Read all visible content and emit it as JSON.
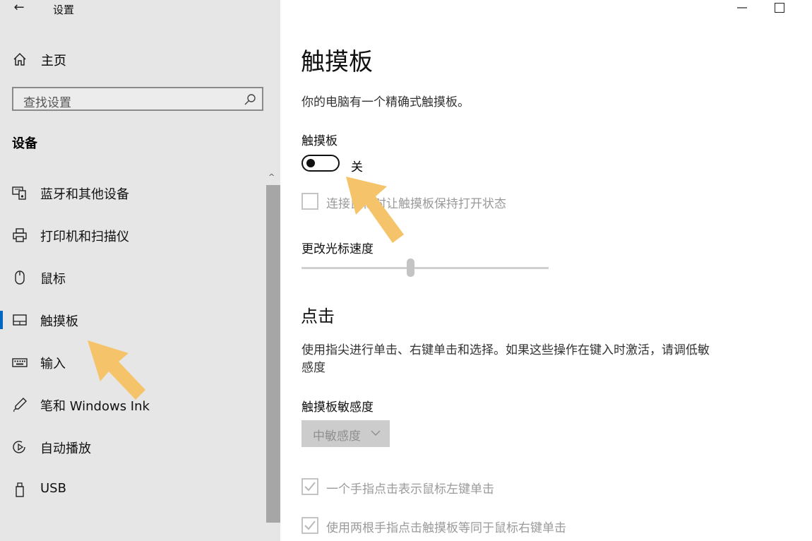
{
  "window": {
    "title": "设置",
    "back_glyph": "←",
    "minimize_icon": "minimize-icon",
    "maximize_icon": "maximize-icon"
  },
  "sidebar": {
    "home_label": "主页",
    "search_placeholder": "查找设置",
    "section_title": "设备",
    "items": [
      {
        "label": "蓝牙和其他设备",
        "icon": "bluetooth-devices-icon"
      },
      {
        "label": "打印机和扫描仪",
        "icon": "printer-icon"
      },
      {
        "label": "鼠标",
        "icon": "mouse-icon"
      },
      {
        "label": "触摸板",
        "icon": "touchpad-icon",
        "active": true
      },
      {
        "label": "输入",
        "icon": "keyboard-icon"
      },
      {
        "label": "笔和 Windows Ink",
        "icon": "pen-icon"
      },
      {
        "label": "自动播放",
        "icon": "autoplay-icon"
      },
      {
        "label": "USB",
        "icon": "usb-icon"
      }
    ]
  },
  "main": {
    "title": "触摸板",
    "description": "你的电脑有一个精确式触摸板。",
    "touchpad_label": "触摸板",
    "toggle_state": "关",
    "toggle_on": false,
    "leave_on_checkbox": "连接鼠标时让触摸板保持打开状态",
    "cursor_speed_label": "更改光标速度",
    "cursor_speed_value": 0.44,
    "taps_title": "点击",
    "taps_description": "使用指尖进行单击、右键单击和选择。如果这些操作在键入时激活，请调低敏感度",
    "sensitivity_label": "触摸板敏感度",
    "sensitivity_value": "中敏感度",
    "tap_options": [
      {
        "label": "一个手指点击表示鼠标左键单击",
        "checked": true
      },
      {
        "label": "使用两根手指点击触摸板等同于鼠标右键单击",
        "checked": true
      }
    ]
  },
  "colors": {
    "sidebar_bg": "#e6e6e6",
    "accent": "#0067c0",
    "annotation_arrow": "#f5c46a",
    "disabled_text": "#9a9a9a"
  }
}
